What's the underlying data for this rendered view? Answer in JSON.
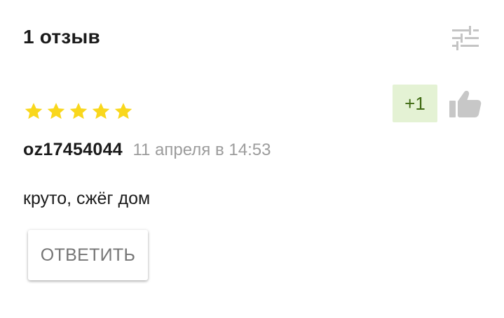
{
  "header": {
    "title": "1 отзыв",
    "filter_icon": "sliders-icon"
  },
  "review": {
    "rating": 5,
    "rating_max": 5,
    "star_color": "#f9d71c",
    "author": "oz17454044",
    "date": "11 апреля в 14:53",
    "text": "круто, сжёг дом",
    "votes": "+1",
    "vote_badge_bg": "#e4f2d4",
    "vote_text_color": "#3f6a12",
    "like_icon": "thumbs-up-icon",
    "reply_label": "ОТВЕТИТЬ"
  }
}
